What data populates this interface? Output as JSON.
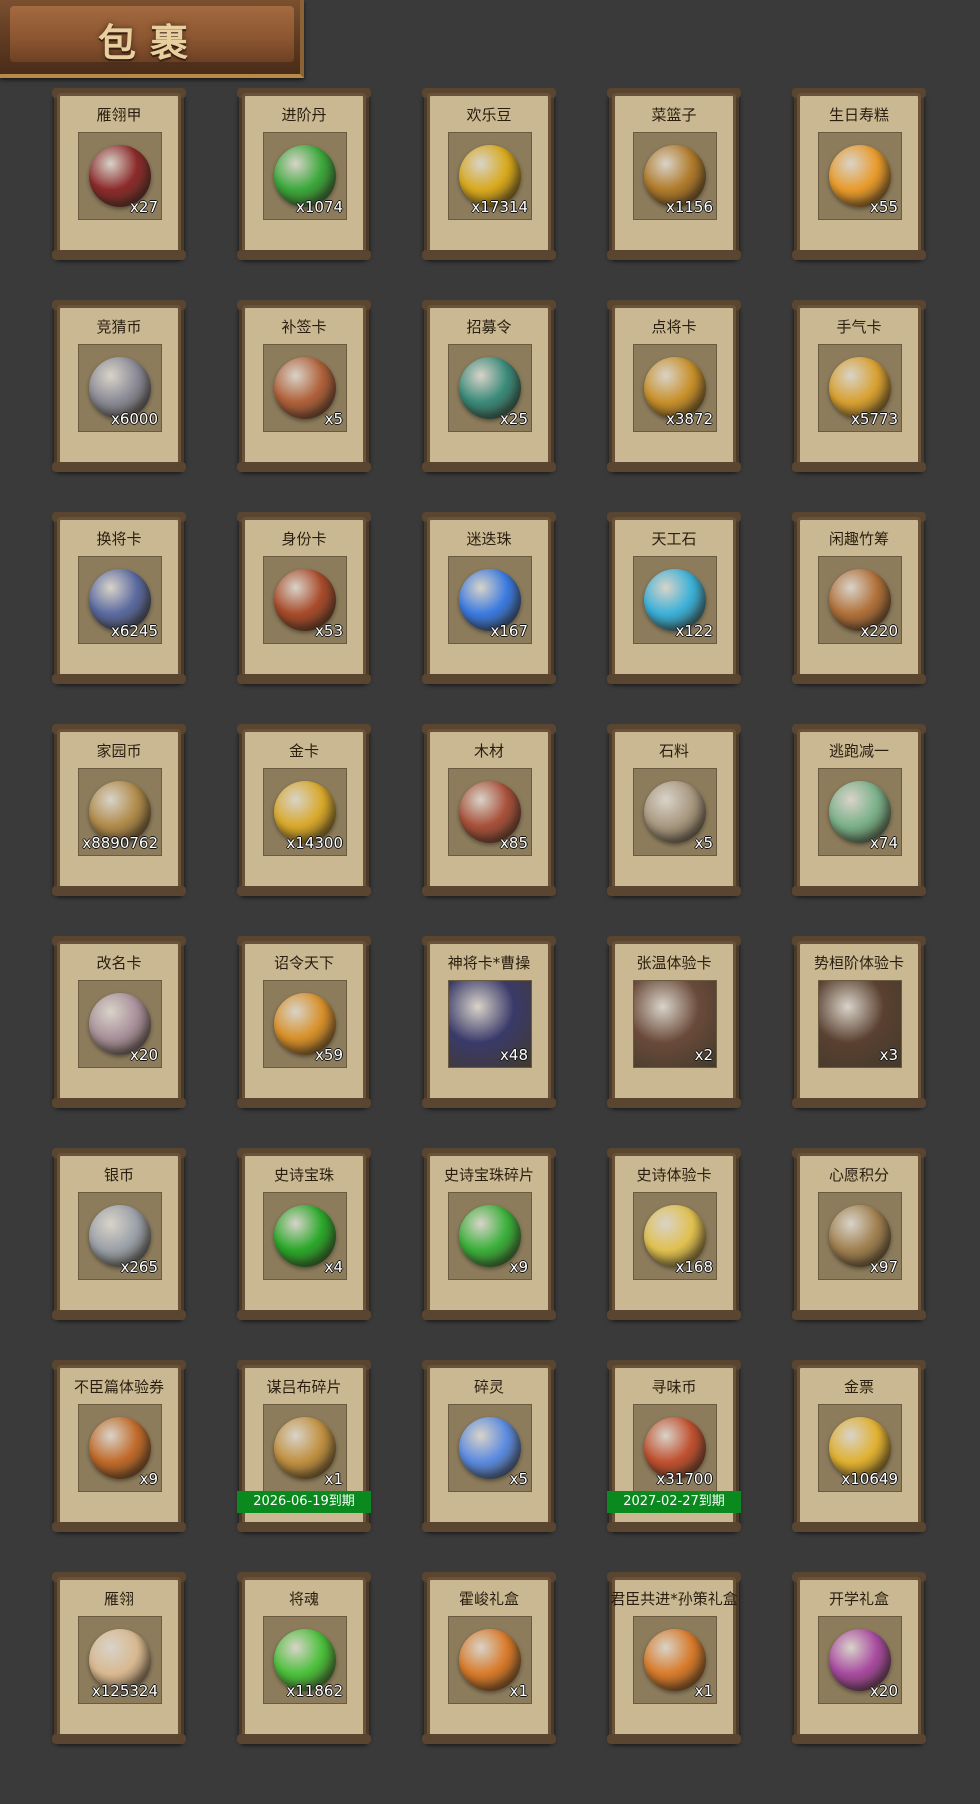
{
  "header": {
    "title": "包裹"
  },
  "items": [
    {
      "name": "雁翎甲",
      "count": "x27",
      "icon": "armor-icon",
      "color": "#8b2a2a"
    },
    {
      "name": "进阶丹",
      "count": "x1074",
      "icon": "green-pill-icon",
      "color": "#3aa83a"
    },
    {
      "name": "欢乐豆",
      "count": "x17314",
      "icon": "gold-beans-icon",
      "color": "#d8a81c"
    },
    {
      "name": "菜篮子",
      "count": "x1156",
      "icon": "basket-icon",
      "color": "#b07a2a"
    },
    {
      "name": "生日寿糕",
      "count": "x55",
      "icon": "cake-icon",
      "color": "#e89a2a"
    },
    {
      "name": "竞猜币",
      "count": "x6000",
      "icon": "silver-coin-icon",
      "color": "#8a8a96"
    },
    {
      "name": "补签卡",
      "count": "x5",
      "icon": "card-icon",
      "color": "#b0603a"
    },
    {
      "name": "招募令",
      "count": "x25",
      "icon": "recruit-token-icon",
      "color": "#3a8a7a"
    },
    {
      "name": "点将卡",
      "count": "x3872",
      "icon": "general-card-icon",
      "color": "#c8902a"
    },
    {
      "name": "手气卡",
      "count": "x5773",
      "icon": "luck-card-icon",
      "color": "#d8a030"
    },
    {
      "name": "换将卡",
      "count": "x6245",
      "icon": "swap-card-icon",
      "color": "#5a6aa0"
    },
    {
      "name": "身份卡",
      "count": "x53",
      "icon": "identity-card-icon",
      "color": "#a84a2a"
    },
    {
      "name": "迷迭珠",
      "count": "x167",
      "icon": "blue-orb-icon",
      "color": "#3a7ae0"
    },
    {
      "name": "天工石",
      "count": "x122",
      "icon": "crystal-icon",
      "color": "#3ab0d8"
    },
    {
      "name": "闲趣竹筹",
      "count": "x220",
      "icon": "bamboo-token-icon",
      "color": "#b0703a"
    },
    {
      "name": "家园币",
      "count": "x8890762",
      "icon": "home-coin-icon",
      "color": "#b08a4a"
    },
    {
      "name": "金卡",
      "count": "x14300",
      "icon": "gold-card-icon",
      "color": "#d8a82a"
    },
    {
      "name": "木材",
      "count": "x85",
      "icon": "wood-icon",
      "color": "#a8503a"
    },
    {
      "name": "石料",
      "count": "x5",
      "icon": "stone-icon",
      "color": "#a89880"
    },
    {
      "name": "逃跑减一",
      "count": "x74",
      "icon": "jade-tag-icon",
      "color": "#7ab08a"
    },
    {
      "name": "改名卡",
      "count": "x20",
      "icon": "rename-card-icon",
      "color": "#a8909a"
    },
    {
      "name": "诏令天下",
      "count": "x59",
      "icon": "scroll-icon",
      "color": "#d8902a"
    },
    {
      "name": "神将卡*曹操",
      "count": "x48",
      "icon": "hero-portrait-icon",
      "color": "#3a3a6a",
      "portrait": true
    },
    {
      "name": "张温体验卡",
      "count": "x2",
      "icon": "hero-portrait-icon",
      "color": "#6a4a3a",
      "portrait": true
    },
    {
      "name": "势桓阶体验卡",
      "count": "x3",
      "icon": "hero-portrait-icon",
      "color": "#5a4030",
      "portrait": true
    },
    {
      "name": "银币",
      "count": "x265",
      "icon": "silver-coins-icon",
      "color": "#9aa0a8"
    },
    {
      "name": "史诗宝珠",
      "count": "x4",
      "icon": "green-orb-icon",
      "color": "#2aa82a"
    },
    {
      "name": "史诗宝珠碎片",
      "count": "x9",
      "icon": "green-shard-icon",
      "color": "#3ab03a"
    },
    {
      "name": "史诗体验卡",
      "count": "x168",
      "icon": "gold-ticket-icon",
      "color": "#e0c050"
    },
    {
      "name": "心愿积分",
      "count": "x97",
      "icon": "heart-coin-icon",
      "color": "#a08050"
    },
    {
      "name": "不臣篇体验券",
      "count": "x9",
      "icon": "ticket-icon",
      "color": "#c06a2a"
    },
    {
      "name": "谋吕布碎片",
      "count": "x1",
      "icon": "puzzle-icon",
      "color": "#c09040",
      "expire": "2026-06-19到期"
    },
    {
      "name": "碎灵",
      "count": "x5",
      "icon": "blue-shard-icon",
      "color": "#5a8ae0"
    },
    {
      "name": "寻味币",
      "count": "x31700",
      "icon": "flavor-coin-icon",
      "color": "#c05030",
      "expire": "2027-02-27到期"
    },
    {
      "name": "金票",
      "count": "x10649",
      "icon": "gold-scroll-icon",
      "color": "#e0b030"
    },
    {
      "name": "雁翎",
      "count": "x125324",
      "icon": "feather-icon",
      "color": "#d8b890"
    },
    {
      "name": "将魂",
      "count": "x11862",
      "icon": "soul-crystal-icon",
      "color": "#4ac03a"
    },
    {
      "name": "霍峻礼盒",
      "count": "x1",
      "icon": "gift-box-icon",
      "color": "#d87a2a"
    },
    {
      "name": "君臣共进*孙策礼盒",
      "count": "x1",
      "icon": "gift-box-icon",
      "color": "#d87a2a"
    },
    {
      "name": "开学礼盒",
      "count": "x20",
      "icon": "gift-box-icon",
      "color": "#a84aa0"
    }
  ]
}
